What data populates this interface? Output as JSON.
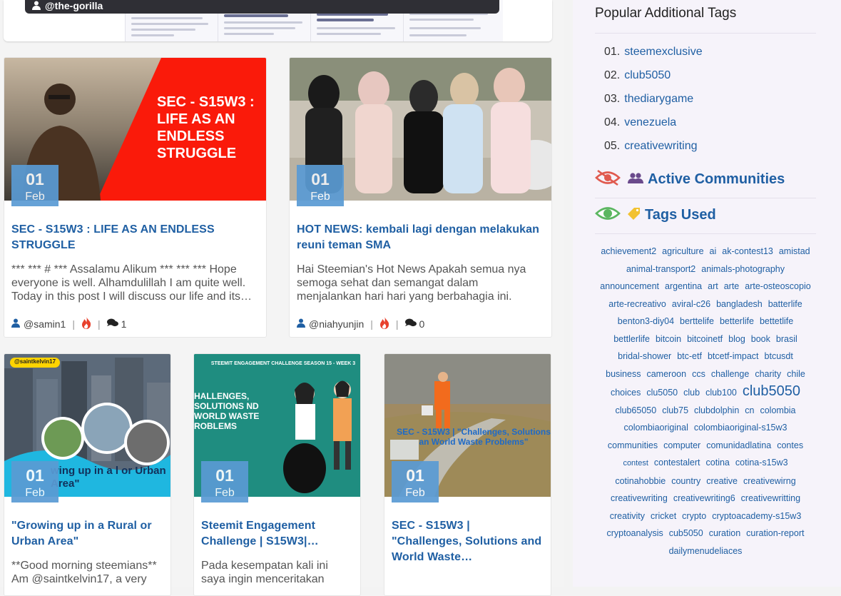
{
  "top_card": {
    "author": "@the-gorilla"
  },
  "posts": [
    {
      "day": "01",
      "month": "Feb",
      "title": "SEC - S15W3 : LIFE AS AN ENDLESS STRUGGLE",
      "excerpt": "*** *** # *** Assalamu Alikum *** *** *** Hope everyone is well. Alhamdulillah I am quite well. Today in this post I will discuss our life and its…",
      "author": "@samin1",
      "comments": "1",
      "banner_text": "SEC - S15W3 : LIFE AS AN ENDLESS STRUGGLE"
    },
    {
      "day": "01",
      "month": "Feb",
      "title": "HOT NEWS: kembali lagi dengan melakukan reuni teman SMA",
      "excerpt": "Hai Steemian's Hot News Apakah semua nya semoga sehat dan semangat dalam menjalankan hari hari yang berbahagia ini. *fot…",
      "author": "@niahyunjin",
      "comments": "0"
    },
    {
      "day": "01",
      "month": "Feb",
      "title": "\"Growing up in a Rural or Urban Area\"",
      "excerpt": "**Good morning steemians** Am @saintkelvin17, a very",
      "banner_tag": "@saintkelvin17",
      "banner_text": "wing up in a l or Urban Area\""
    },
    {
      "day": "01",
      "month": "Feb",
      "title": "Steemit Engagement Challenge | S15W3|…",
      "excerpt": "Pada kesempatan kali ini saya ingin menceritakan tentang",
      "banner_head": "STEEMIT ENGAGEMENT CHALLENGE SEASON 15 - WEEK 3",
      "banner_text": "HALLENGES, SOLUTIONS ND WORLD WASTE ROBLEMS"
    },
    {
      "day": "01",
      "month": "Feb",
      "title": "SEC - S15W3 | \"Challenges, Solutions and World Waste…",
      "excerpt": "",
      "banner_text": "SEC - S15W3 | \"Challenges, Solutions an World Waste Problems\""
    }
  ],
  "sidebar": {
    "popular_heading": "Popular Additional Tags",
    "popular": [
      {
        "num": "01.",
        "tag": "steemexclusive"
      },
      {
        "num": "02.",
        "tag": "club5050"
      },
      {
        "num": "03.",
        "tag": "thediarygame"
      },
      {
        "num": "04.",
        "tag": "venezuela"
      },
      {
        "num": "05.",
        "tag": "creativewriting"
      }
    ],
    "active_communities": "Active Communities",
    "tags_used": "Tags Used",
    "tags": [
      "achievement2",
      "agriculture",
      "ai",
      "ak-contest13",
      "amistad",
      "animal-transport2",
      "animals-photography",
      "announcement",
      "argentina",
      "art",
      "arte",
      "arte-osteoscopio",
      "arte-recreativo",
      "aviral-c26",
      "bangladesh",
      "batterlife",
      "benton3-diy04",
      "berttelife",
      "betterlife",
      "bettetlife",
      "bettlerlife",
      "bitcoin",
      "bitcoinetf",
      "blog",
      "book",
      "brasil",
      "bridal-shower",
      "btc-etf",
      "btcetf-impact",
      "btcusdt",
      "business",
      "cameroon",
      "ccs",
      "challenge",
      "charity",
      "chile",
      "choices",
      "clu5050",
      "club",
      "club100",
      "club5050",
      "club65050",
      "club75",
      "clubdolphin",
      "cn",
      "colombia",
      "colombiaoriginal",
      "colombiaoriginal-s15w3",
      "communities",
      "computer",
      "comunidadlatina",
      "contes",
      "contest",
      "contestalert",
      "cotina",
      "cotina-s15w3",
      "cotinahobbie",
      "country",
      "creative",
      "creativewirng",
      "creativewriting",
      "creativewriting6",
      "creativewritting",
      "creativity",
      "cricket",
      "crypto",
      "cryptoacademy-s15w3",
      "cryptoanalysis",
      "cub5050",
      "curation",
      "curation-report",
      "dailymenudeliaces"
    ]
  },
  "colors": {
    "accent": "#1f5fa3",
    "date_badge": "#5a9bd4",
    "fire": "#e8402c",
    "eye_green": "#5bb660",
    "eye_red": "#e05a4f"
  }
}
